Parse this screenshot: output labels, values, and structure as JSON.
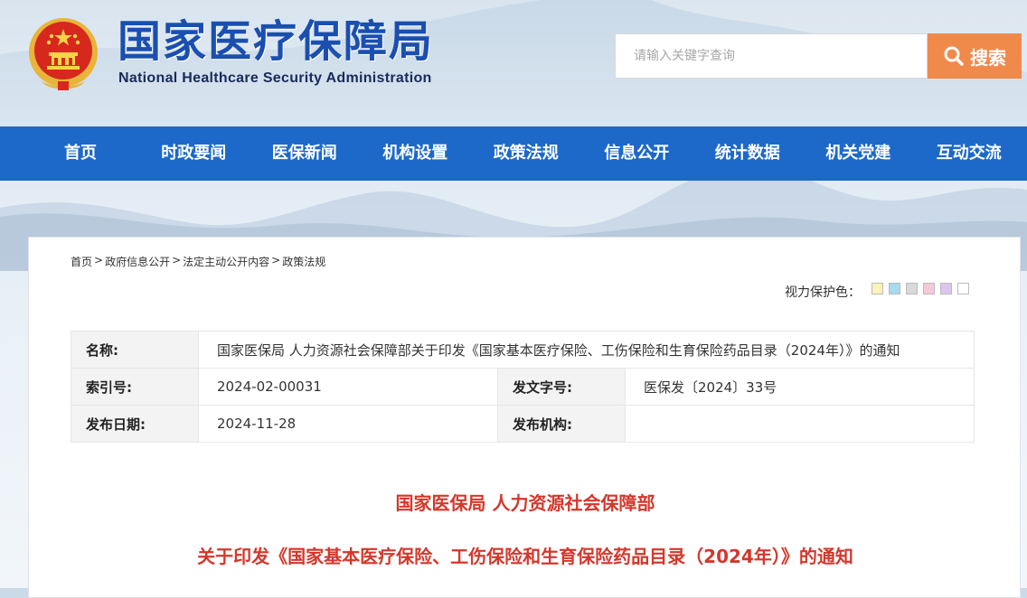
{
  "header": {
    "title": "国家医疗保障局",
    "subtitle": "National Healthcare Security Administration",
    "search_placeholder": "请输入关键字查询",
    "search_label": "搜索"
  },
  "nav": {
    "items": [
      "首页",
      "时政要闻",
      "医保新闻",
      "机构设置",
      "政策法规",
      "信息公开",
      "统计数据",
      "机关党建",
      "互动交流"
    ]
  },
  "breadcrumb": [
    "首页",
    "政府信息公开",
    "法定主动公开内容",
    "政策法规"
  ],
  "vision": {
    "label": "视力保护色：",
    "swatches": [
      "#fbf3b8",
      "#a7dbf0",
      "#d9d9d9",
      "#f6c9d8",
      "#dcc6f0",
      "#ffffff"
    ]
  },
  "info": {
    "name_label": "名称:",
    "name_value": "国家医保局 人力资源社会保障部关于印发《国家基本医疗保险、工伤保险和生育保险药品目录（2024年）》的通知",
    "index_label": "索引号:",
    "index_value": "2024-02-00031",
    "doc_no_label": "发文字号:",
    "doc_no_value": "医保发〔2024〕33号",
    "date_label": "发布日期:",
    "date_value": "2024-11-28",
    "org_label": "发布机构:",
    "org_value": ""
  },
  "document": {
    "issuer": "国家医保局 人力资源社会保障部",
    "title": "关于印发《国家基本医疗保险、工伤保险和生育保险药品目录（2024年）》的通知"
  },
  "colors": {
    "nav_bg": "#1c69c9",
    "search_btn": "#f08a4b",
    "doc_title": "#d4372b",
    "brand_blue": "#1a4fb0"
  }
}
